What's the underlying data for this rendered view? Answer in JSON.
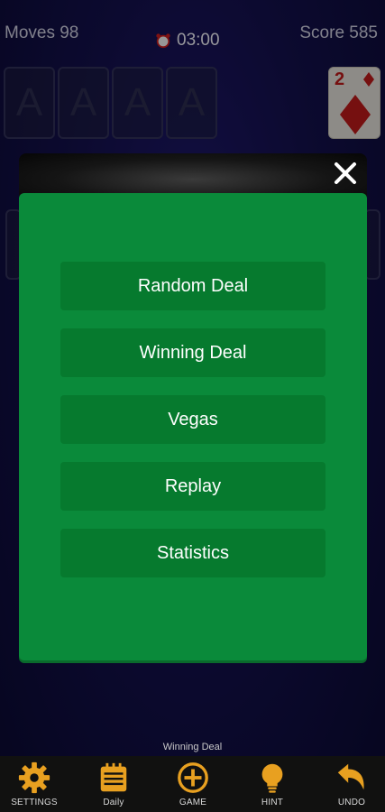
{
  "hud": {
    "moves": "Moves 98",
    "timer": "03:00",
    "score": "Score 585"
  },
  "foundations": [
    "A",
    "A",
    "A",
    "A"
  ],
  "stock_card": {
    "rank": "2",
    "suit": "diamond"
  },
  "modal": {
    "close_icon": "close-icon",
    "buttons": [
      {
        "label": "Random Deal"
      },
      {
        "label": "Winning Deal"
      },
      {
        "label": "Vegas"
      },
      {
        "label": "Replay"
      },
      {
        "label": "Statistics"
      }
    ]
  },
  "deal_label": "Winning Deal",
  "toolbar": {
    "settings": "SETTINGS",
    "daily": "Daily",
    "game": "GAME",
    "hint": "HINT",
    "undo": "UNDO"
  },
  "colors": {
    "accent_orange": "#e8a020",
    "modal_green": "#0a8a3a",
    "button_green": "#067a2e",
    "card_red": "#b51a1a"
  }
}
